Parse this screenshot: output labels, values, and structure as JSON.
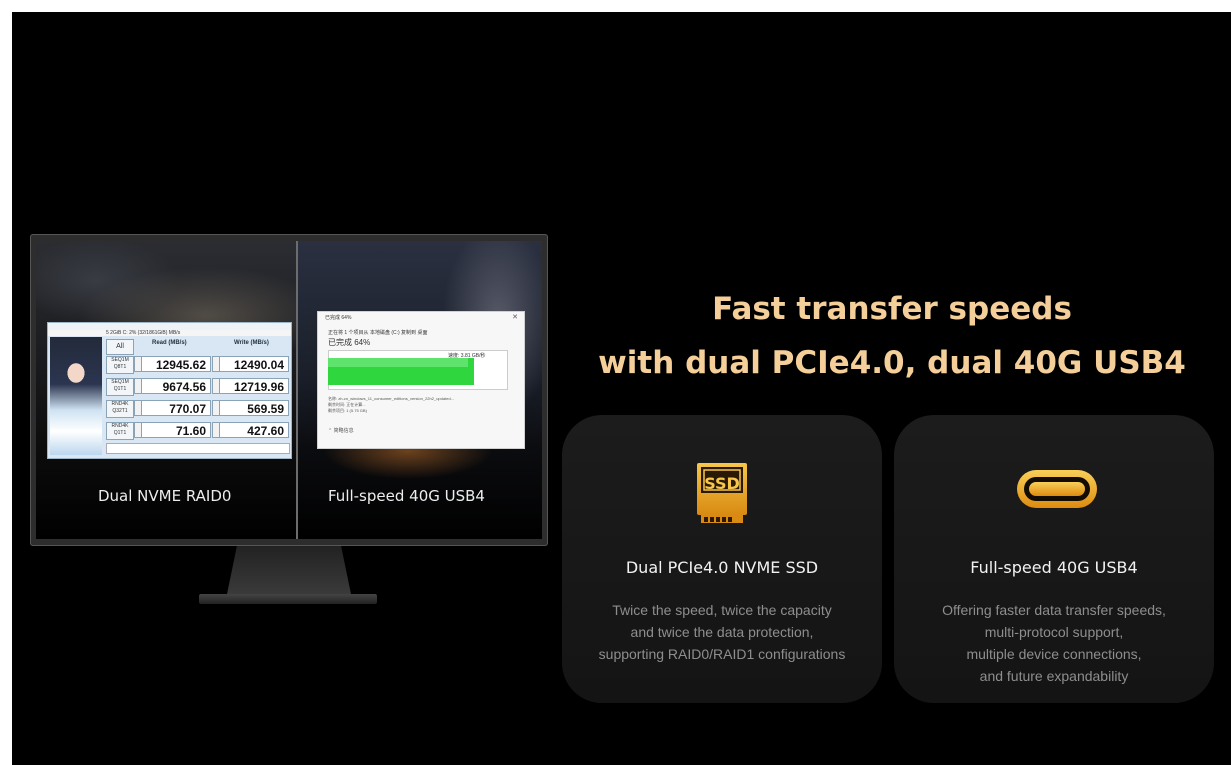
{
  "headline": {
    "line1": "Fast transfer speeds",
    "line2": "with dual PCIe4.0, dual 40G USB4"
  },
  "monitor": {
    "left_caption": "Dual NVME RAID0",
    "right_caption": "Full-speed 40G USB4",
    "benchmark": {
      "toolbar": "5   2GiB   C: 2% (32/1861GiB)   MB/s",
      "all_button": "All",
      "read_header": "Read (MB/s)",
      "write_header": "Write (MB/s)",
      "rows": [
        {
          "label": "SEQ1M Q8T1",
          "read": "12945.62",
          "write": "12490.04"
        },
        {
          "label": "SEQ1M Q1T1",
          "read": "9674.56",
          "write": "12719.96"
        },
        {
          "label": "RND4K Q32T1",
          "read": "770.07",
          "write": "569.59"
        },
        {
          "label": "RND4K Q1T1",
          "read": "71.60",
          "write": "427.60"
        }
      ]
    },
    "copy_dialog": {
      "title": "已完成 64%",
      "line1": "正在将 1 个项目从 本地磁盘 (C:) 复制到 桌面",
      "percent": "已完成 64%",
      "speed": "速度: 3.81 GB/秒",
      "progress": 0.64,
      "info_name": "名称: zh-cn_windows_11_consumer_editions_version_22h2_updated...",
      "info_time": "剩余时间: 正在计算...",
      "info_items": "剩余项目: 1 (5.75 GB)",
      "less": "简略信息"
    }
  },
  "features": [
    {
      "icon": "ssd-icon",
      "icon_text": "SSD",
      "title": "Dual PCIe4.0 NVME SSD",
      "desc": [
        "Twice the speed, twice the capacity",
        "and twice the data protection,",
        "supporting RAID0/RAID1 configurations"
      ]
    },
    {
      "icon": "usb-c-icon",
      "title": "Full-speed 40G USB4",
      "desc": [
        "Offering faster data transfer speeds,",
        "multi-protocol support,",
        "multiple device connections,",
        "and future expandability"
      ]
    }
  ],
  "colors": {
    "headline": "#f5cf9a",
    "accent_gold": "#e9a424",
    "background": "#000000",
    "card": "#1a1a1a"
  }
}
